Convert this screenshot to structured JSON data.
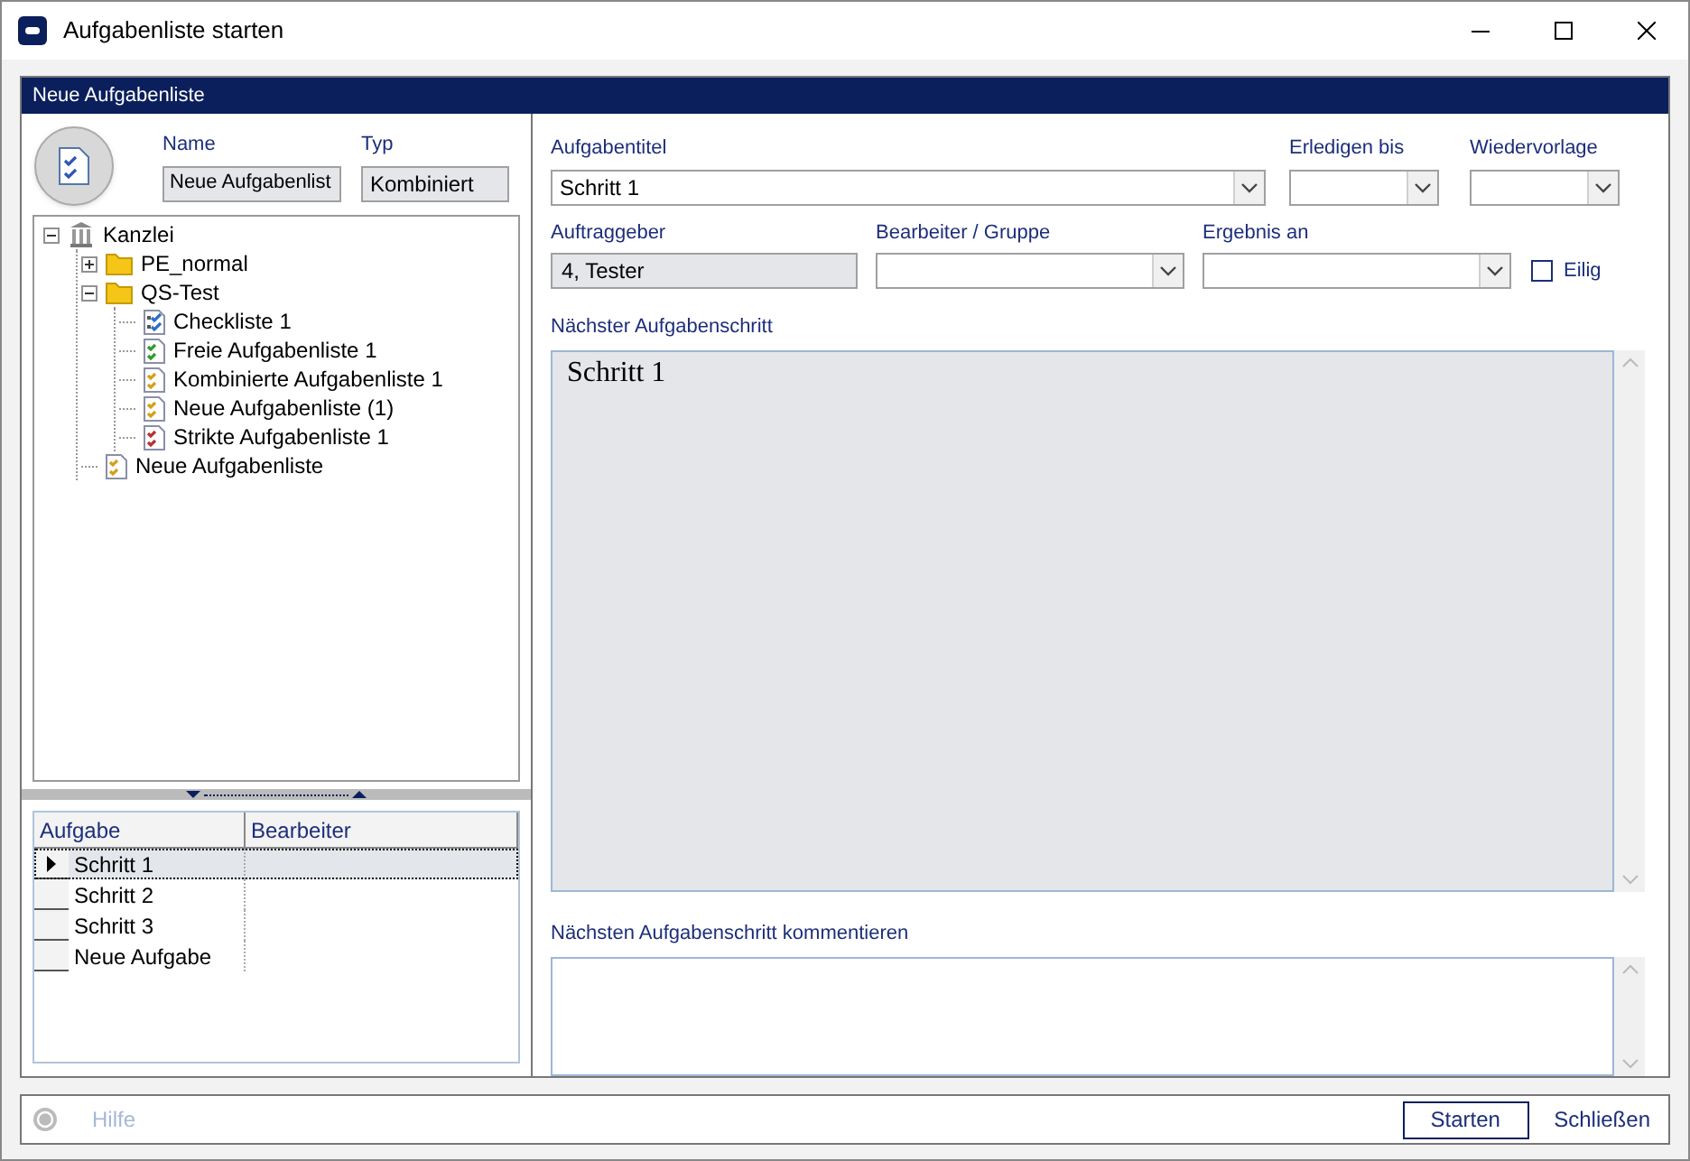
{
  "window": {
    "title": "Aufgabenliste starten"
  },
  "panel": {
    "title": "Neue Aufgabenliste"
  },
  "name_field": {
    "label": "Name",
    "value": "Neue Aufgabenlist"
  },
  "type_field": {
    "label": "Typ",
    "value": "Kombiniert"
  },
  "tree": [
    {
      "label": "Kanzlei",
      "kind": "root",
      "expanded": true,
      "children": [
        {
          "label": "PE_normal",
          "kind": "folder",
          "expanded": false
        },
        {
          "label": "QS-Test",
          "kind": "folder",
          "expanded": true,
          "children": [
            {
              "label": "Checkliste 1",
              "kind": "checklist",
              "color": "#2f6fc4"
            },
            {
              "label": "Freie Aufgabenliste 1",
              "kind": "list",
              "color": "#2e9b2e"
            },
            {
              "label": "Kombinierte Aufgabenliste 1",
              "kind": "list",
              "color": "#d4a017"
            },
            {
              "label": "Neue Aufgabenliste (1)",
              "kind": "list",
              "color": "#d4a017"
            },
            {
              "label": "Strikte Aufgabenliste 1",
              "kind": "list",
              "color": "#b83232"
            }
          ]
        },
        {
          "label": "Neue Aufgabenliste",
          "kind": "list",
          "color": "#d4a017"
        }
      ]
    }
  ],
  "table": {
    "columns": [
      "Aufgabe",
      "Bearbeiter"
    ],
    "rows": [
      {
        "cells": [
          "Schritt 1",
          ""
        ],
        "selected": true
      },
      {
        "cells": [
          "Schritt 2",
          ""
        ],
        "selected": false
      },
      {
        "cells": [
          "Schritt 3",
          ""
        ],
        "selected": false
      },
      {
        "cells": [
          "Neue Aufgabe",
          ""
        ],
        "selected": false
      }
    ]
  },
  "form": {
    "aufgabentitel": {
      "label": "Aufgabentitel",
      "value": "Schritt 1"
    },
    "erledigen_bis": {
      "label": "Erledigen bis"
    },
    "wiedervorlage": {
      "label": "Wiedervorlage"
    },
    "auftraggeber": {
      "label": "Auftraggeber",
      "value": "4, Tester"
    },
    "bearbeiter": {
      "label": "Bearbeiter / Gruppe"
    },
    "ergebnis": {
      "label": "Ergebnis an"
    },
    "eilig": {
      "label": "Eilig",
      "checked": false
    },
    "next_step": {
      "label": "Nächster Aufgabenschritt",
      "value": "Schritt 1"
    },
    "comment": {
      "label": "Nächsten Aufgabenschritt kommentieren"
    }
  },
  "footer": {
    "help": "Hilfe",
    "disabled_help": true,
    "buttons": [
      "Starten",
      "Schließen"
    ]
  }
}
